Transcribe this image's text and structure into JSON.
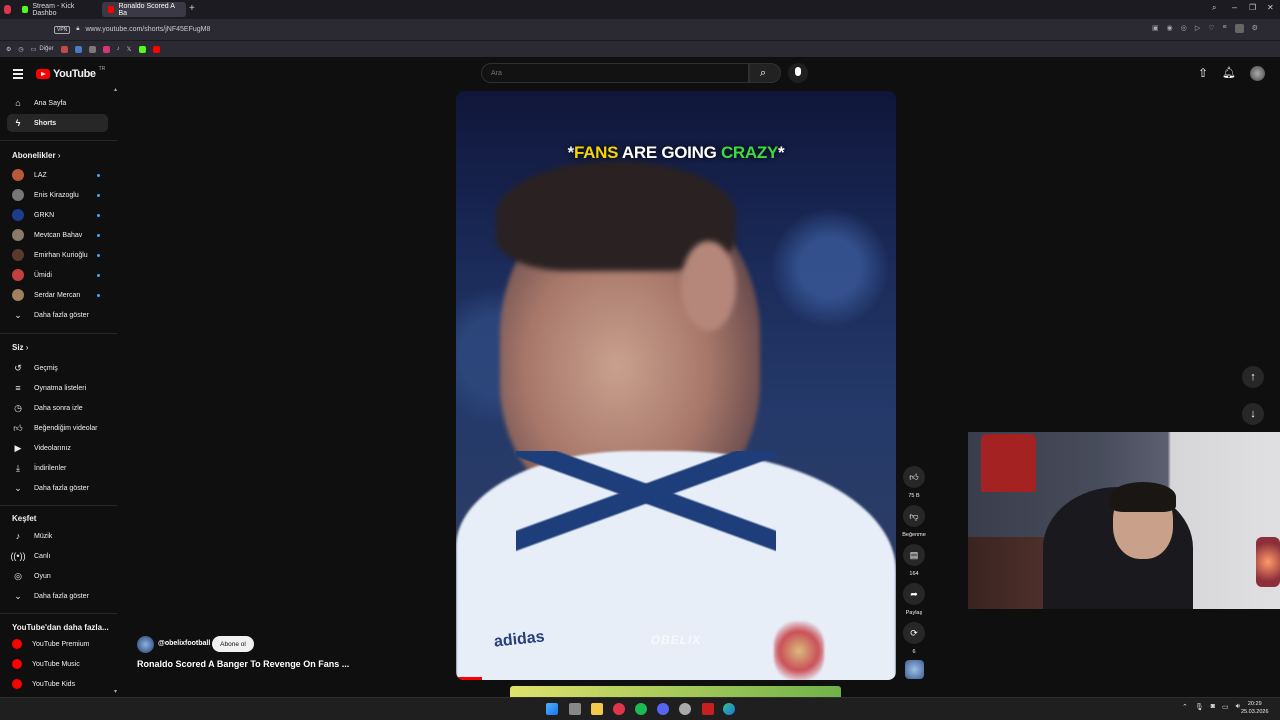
{
  "browser": {
    "tabs": [
      {
        "label": "Stream - Kick Dashbo"
      },
      {
        "label": "Ronaldo Scored A Ba"
      }
    ],
    "url": "www.youtube.com/shorts/jNF45EFugM8",
    "vpn_label": "VPN",
    "bookmarks": {
      "folder": "Diğer"
    }
  },
  "youtube": {
    "logo_text": "YouTube",
    "country_code": "TR",
    "search_placeholder": "Ara"
  },
  "sidebar": {
    "main": [
      {
        "label": "Ana Sayfa",
        "icon": "home-icon"
      },
      {
        "label": "Shorts",
        "icon": "shorts-icon"
      }
    ],
    "subscriptions_title": "Abonelikler",
    "subscriptions": [
      {
        "label": "LAZ",
        "color": "#b85a3a"
      },
      {
        "label": "Enis Kirazoglu",
        "color": "#777777"
      },
      {
        "label": "GRKN",
        "color": "#1e3c8c"
      },
      {
        "label": "Mevtcan Bahav",
        "color": "#8a7a6a"
      },
      {
        "label": "Emirhan Kurioğlu",
        "color": "#5a3a2a"
      },
      {
        "label": "Ümidi",
        "color": "#c24040"
      },
      {
        "label": "Serdar Mercan",
        "color": "#a08060"
      }
    ],
    "show_more": "Daha fazla göster",
    "you_title": "Siz",
    "you_items": [
      {
        "label": "Geçmiş",
        "icon": "history-icon"
      },
      {
        "label": "Oynatma listeleri",
        "icon": "playlists-icon"
      },
      {
        "label": "Daha sonra izle",
        "icon": "clock-icon"
      },
      {
        "label": "Beğendiğim videolar",
        "icon": "thumbs-up-icon"
      },
      {
        "label": "Videolarınız",
        "icon": "video-icon"
      },
      {
        "label": "İndirilenler",
        "icon": "download-icon"
      }
    ],
    "explore_title": "Keşfet",
    "explore_items": [
      {
        "label": "Müzik",
        "icon": "music-icon"
      },
      {
        "label": "Canlı",
        "icon": "live-icon"
      },
      {
        "label": "Oyun",
        "icon": "gamepad-icon"
      }
    ],
    "more_title": "YouTube'dan daha fazla...",
    "more_items": [
      {
        "label": "YouTube Premium"
      },
      {
        "label": "YouTube Music"
      },
      {
        "label": "YouTube Kids"
      }
    ]
  },
  "short": {
    "overlay_parts": [
      "*",
      "FANS",
      " ARE GOING ",
      "CRAZY",
      "*"
    ],
    "watermark": "OBELIX",
    "brand_text": "adidas",
    "channel": "@obelixfootball",
    "subscribe_label": "Abone ol",
    "title": "Ronaldo Scored A Banger To Revenge On Fans ...",
    "likes": "75 B",
    "dislike_label": "Beğenme",
    "comments": "164",
    "share_label": "Paylaş",
    "remix": "6",
    "progress": 0.06
  },
  "taskbar": {
    "time": "20:29",
    "date": "25.03.2026"
  },
  "colors": {
    "accent": "#ff0000",
    "overlay_yellow": "#f5d400",
    "overlay_green": "#3ddc3d",
    "live_dot": "#3ea6ff"
  }
}
